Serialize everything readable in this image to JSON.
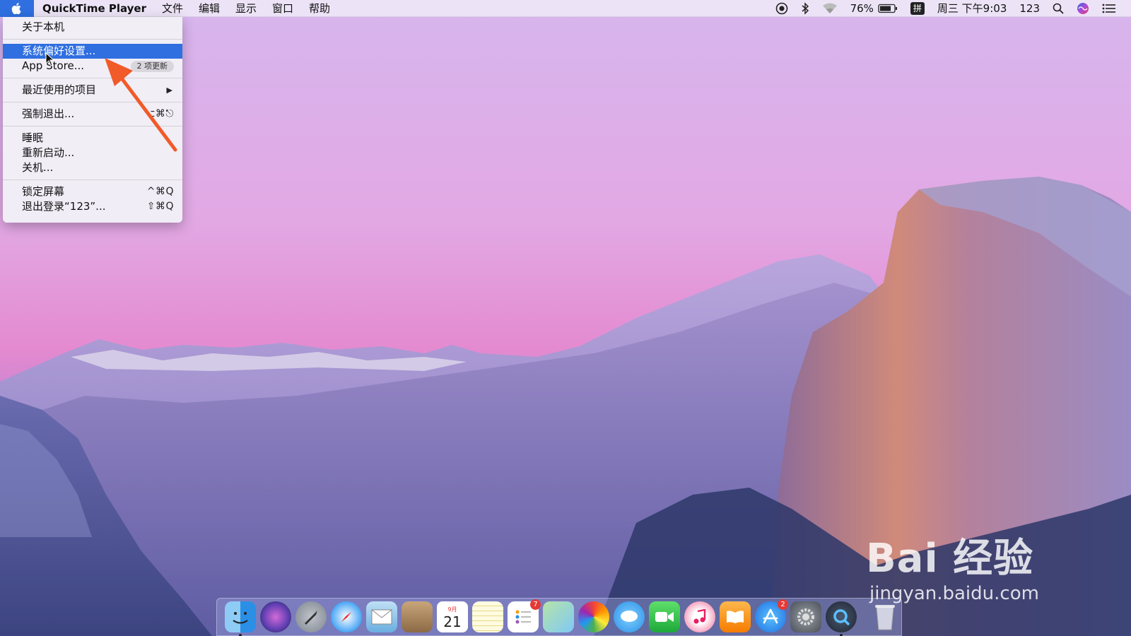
{
  "menubar": {
    "app_name": "QuickTime Player",
    "menus": [
      "文件",
      "编辑",
      "显示",
      "窗口",
      "帮助"
    ],
    "status": {
      "battery_percent": "76%",
      "ime": "拼",
      "clock": "周三 下午9:03",
      "user": "123"
    }
  },
  "apple_menu": {
    "items": [
      {
        "label": "关于本机"
      },
      {
        "label": "系统偏好设置..."
      },
      {
        "label": "App Store...",
        "badge": "2 项更新"
      },
      {
        "label": "最近使用的项目"
      },
      {
        "label": "强制退出...",
        "shortcut": "⌥⌘⎋"
      },
      {
        "label": "睡眠"
      },
      {
        "label": "重新启动..."
      },
      {
        "label": "关机..."
      },
      {
        "label": "锁定屏幕",
        "shortcut": "^⌘Q"
      },
      {
        "label": "退出登录“123”...",
        "shortcut": "⇧⌘Q"
      }
    ],
    "selected_index": 1
  },
  "dock": {
    "icons": [
      "finder-icon",
      "siri-icon",
      "launchpad-icon",
      "safari-icon",
      "mail-icon",
      "contacts-icon",
      "calendar-icon",
      "notes-icon",
      "reminders-icon",
      "maps-icon",
      "photos-icon",
      "messages-icon",
      "facetime-icon",
      "itunes-icon",
      "ibooks-icon",
      "app-store-icon",
      "system-preferences-icon",
      "quicktime-icon",
      "trash-icon"
    ],
    "calendar_month": "9月",
    "calendar_day": "21",
    "reminders_badge": "7",
    "app_store_badge": "2"
  },
  "watermark": {
    "logo": "Bai 经验",
    "url": "jingyan.baidu.com"
  },
  "colors": {
    "accent": "#2f6fe0",
    "annotation_arrow": "#f15a29"
  }
}
